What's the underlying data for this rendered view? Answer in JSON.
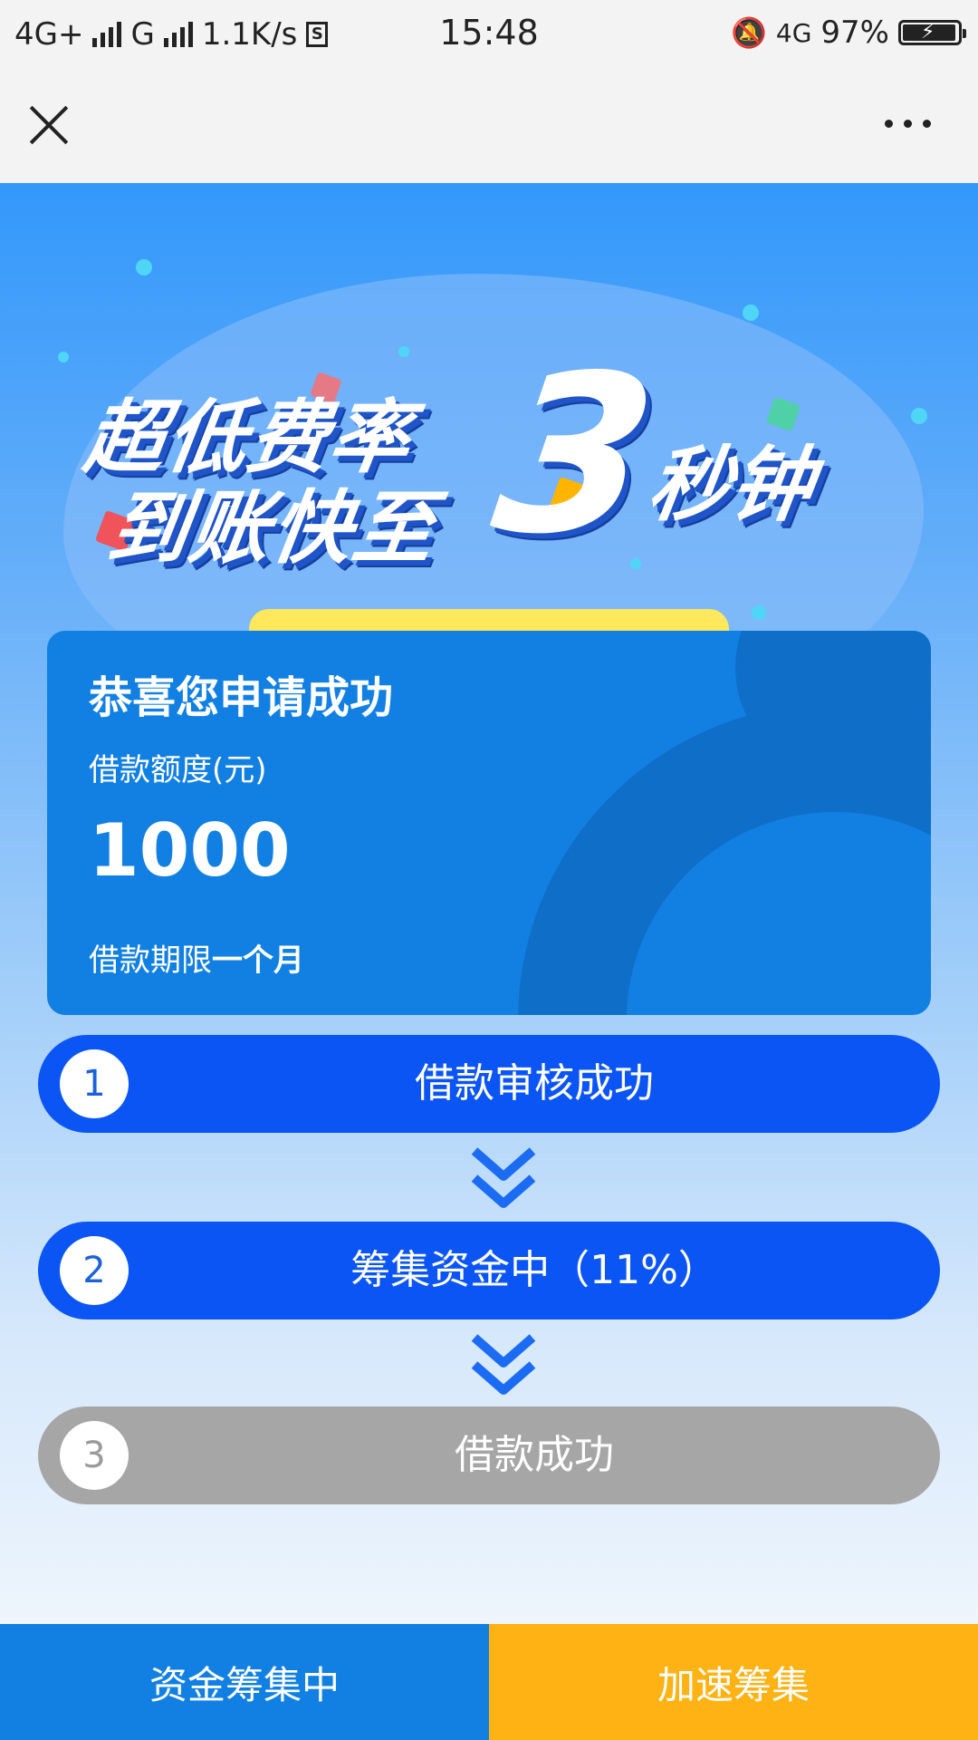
{
  "status_bar": {
    "network1": "4G+",
    "network2": "G",
    "speed": "1.1K/s",
    "time": "15:48",
    "network3": "4G",
    "battery": "97%"
  },
  "banner": {
    "line1": "超低费率",
    "line2": "到账快至",
    "big_number": "3",
    "line3": "秒钟"
  },
  "card": {
    "title": "恭喜您申请成功",
    "amount_label": "借款额度(元)",
    "amount": "1000",
    "term_label": "借款期限",
    "term_value": "一个月"
  },
  "steps": [
    {
      "num": "1",
      "label": "借款审核成功",
      "status": "active"
    },
    {
      "num": "2",
      "label": "筹集资金中（11%）",
      "status": "active"
    },
    {
      "num": "3",
      "label": "借款成功",
      "status": "inactive"
    }
  ],
  "bottom": {
    "left_label": "资金筹集中",
    "right_label": "加速筹集"
  },
  "colors": {
    "primary_blue": "#1280e3",
    "step_active": "#0b55f5",
    "step_inactive": "#a6a6a6",
    "accent_orange": "#ffb213"
  }
}
